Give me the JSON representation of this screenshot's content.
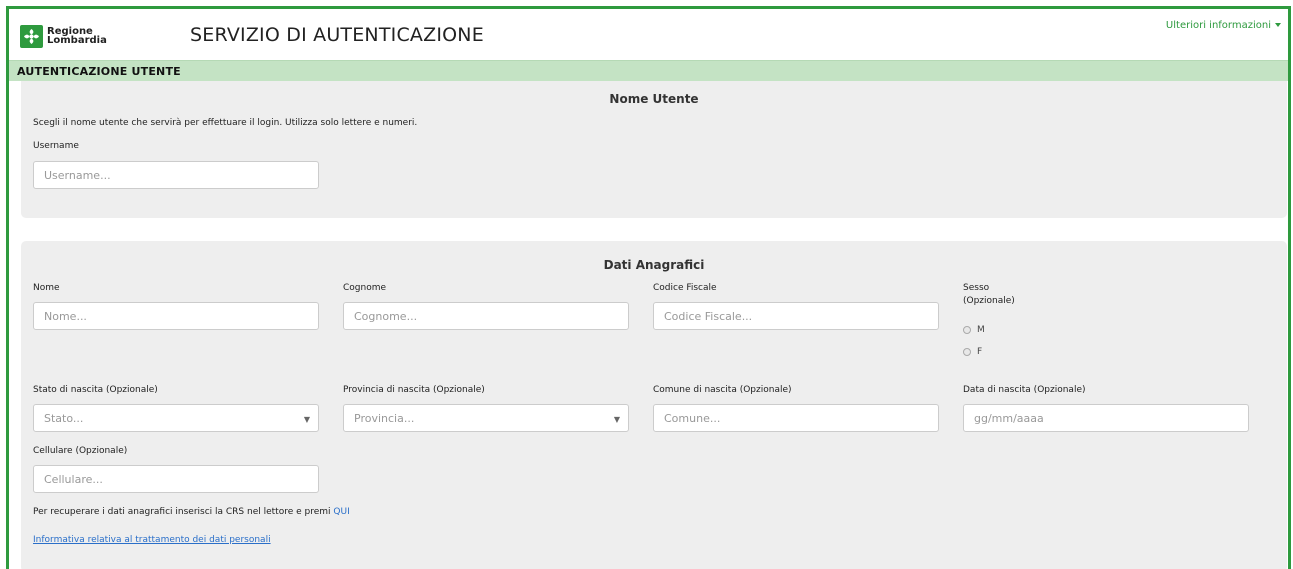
{
  "header": {
    "logo_line1": "Regione",
    "logo_line2": "Lombardia",
    "title": "SERVIZIO DI AUTENTICAZIONE",
    "more_info": "Ulteriori informazioni"
  },
  "section": {
    "title": "AUTENTICAZIONE UTENTE"
  },
  "username_panel": {
    "title": "Nome Utente",
    "hint": "Scegli il nome utente che servirà per effettuare il login. Utilizza solo lettere e numeri.",
    "username_label": "Username",
    "username_placeholder": "Username..."
  },
  "anagrafica": {
    "title": "Dati Anagrafici",
    "nome_label": "Nome",
    "nome_placeholder": "Nome...",
    "cognome_label": "Cognome",
    "cognome_placeholder": "Cognome...",
    "cf_label": "Codice Fiscale",
    "cf_placeholder": "Codice Fiscale...",
    "sesso_label": "Sesso",
    "sesso_optional": "(Opzionale)",
    "sesso_options": [
      "M",
      "F"
    ],
    "stato_label": "Stato di nascita (Opzionale)",
    "stato_placeholder": "Stato...",
    "provincia_label": "Provincia di nascita (Opzionale)",
    "provincia_placeholder": "Provincia...",
    "comune_label": "Comune di nascita (Opzionale)",
    "comune_placeholder": "Comune...",
    "data_label": "Data di nascita (Opzionale)",
    "data_placeholder": "gg/mm/aaaa",
    "cellulare_label": "Cellulare (Opzionale)",
    "cellulare_placeholder": "Cellulare...",
    "crs_hint": "Per recuperare i dati anagrafici inserisci la CRS nel lettore e premi",
    "crs_link": "QUI",
    "privacy_link": "Informativa relativa al trattamento dei dati personali"
  },
  "colors": {
    "accent_green": "#2e9a3e",
    "section_bar": "#c4e3c4",
    "panel_bg": "#eeeeee",
    "link_blue": "#2a6fc9"
  }
}
